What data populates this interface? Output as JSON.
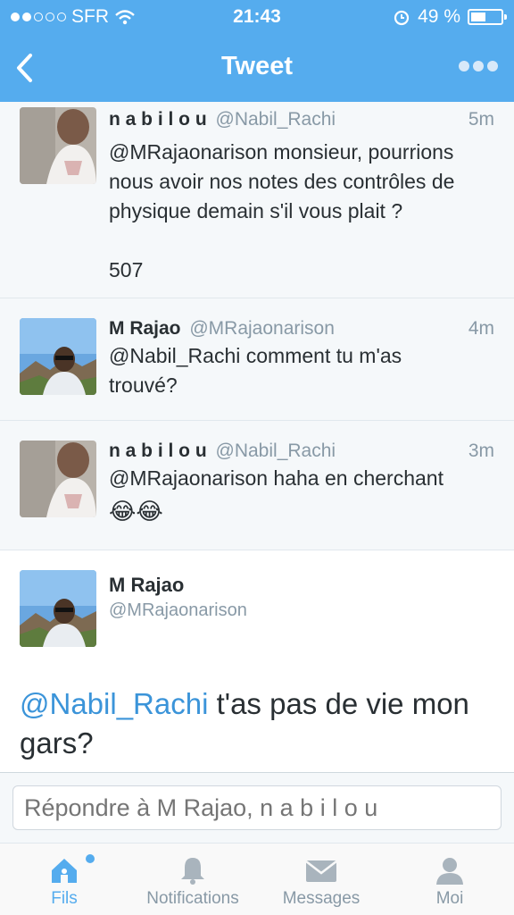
{
  "status_bar": {
    "carrier": "SFR",
    "time": "21:43",
    "battery": "49 %",
    "battery_level": 0.49
  },
  "nav": {
    "title": "Tweet"
  },
  "tweets": [
    {
      "name": "n a b i l o u",
      "handle": "@Nabil_Rachi",
      "ago": "5m",
      "text_line1": "@MRajaonarison monsieur, pourrions",
      "text_line2": "nous avoir nos notes des contrôles de",
      "text_line3": "physique demain s'il vous plait ?",
      "text_line4": "507"
    },
    {
      "name": "M Rajao",
      "handle": "@MRajaonarison",
      "ago": "4m",
      "text_line1": "@Nabil_Rachi comment tu m'as",
      "text_line2": "trouvé?"
    },
    {
      "name": "n a b i l o u",
      "handle": "@Nabil_Rachi",
      "ago": "3m",
      "text_line1": "@MRajaonarison haha en cherchant",
      "emojis": "😂😂"
    }
  ],
  "detail": {
    "name": "M Rajao",
    "handle": "@MRajaonarison",
    "mention": "@Nabil_Rachi",
    "text_line1_rest": " t'as pas de vie mon",
    "text_line2": "gars?"
  },
  "reply": {
    "placeholder": "Répondre à M Rajao, n a b i l o u"
  },
  "tabs": [
    {
      "label": "Fils",
      "icon": "home-icon",
      "active": true
    },
    {
      "label": "Notifications",
      "icon": "bell-icon",
      "active": false
    },
    {
      "label": "Messages",
      "icon": "envelope-icon",
      "active": false
    },
    {
      "label": "Moi",
      "icon": "person-icon",
      "active": false
    }
  ],
  "colors": {
    "brand": "#55acee",
    "link": "#3b94d9",
    "muted": "#8899a6"
  }
}
